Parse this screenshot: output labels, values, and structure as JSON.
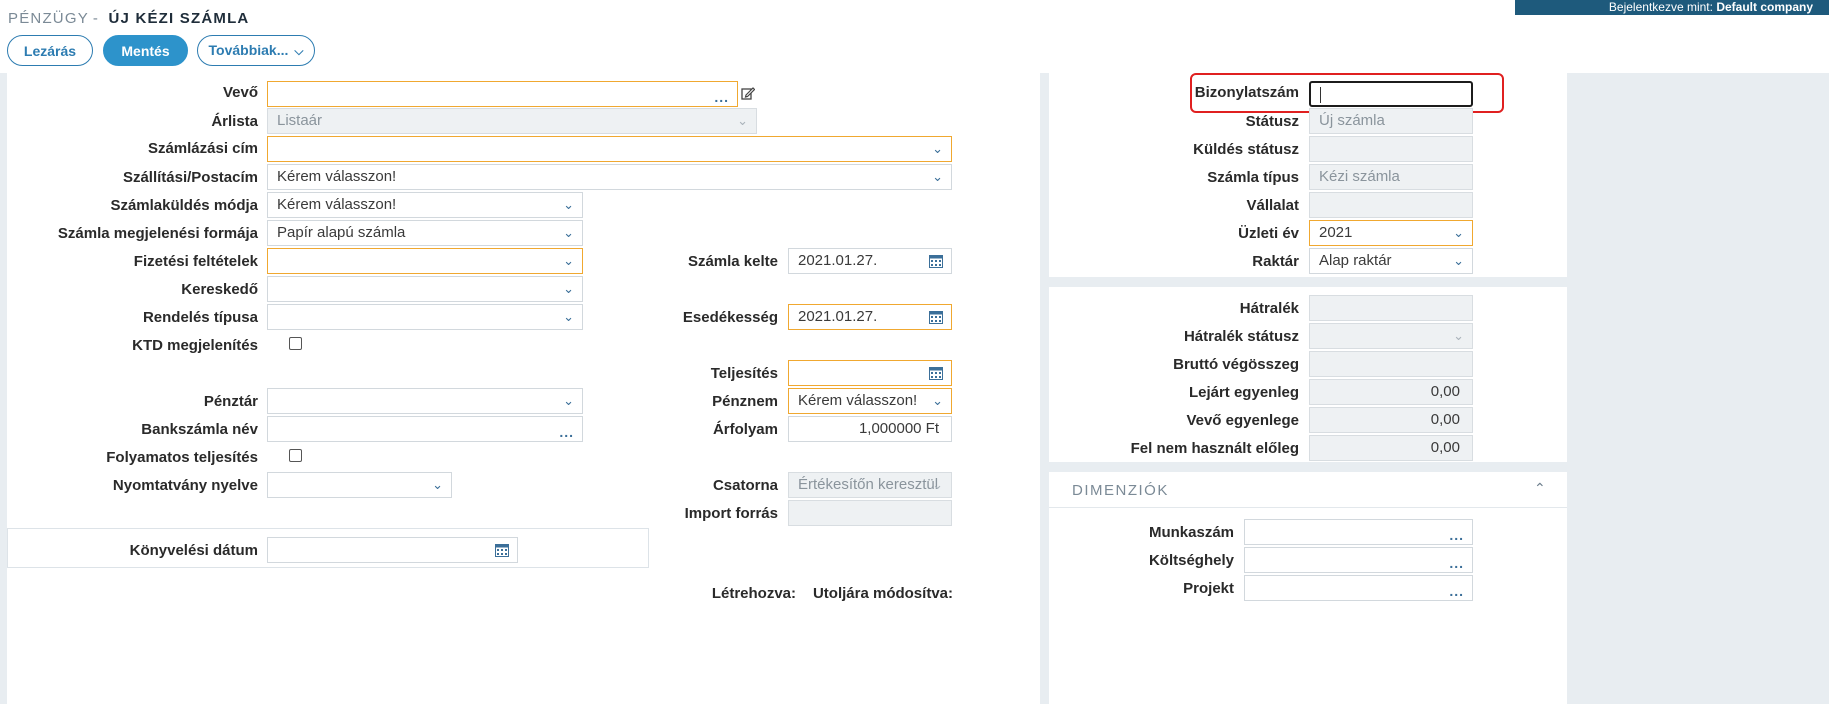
{
  "header": {
    "breadcrumb_section": "PÉNZÜGY",
    "breadcrumb_sep": "-",
    "page_title": "ÚJ KÉZI SZÁMLA",
    "login_prefix": "Bejelentkezve mint:",
    "login_company": "Default company"
  },
  "toolbar": {
    "close_label": "Lezárás",
    "save_label": "Mentés",
    "more_label": "Továbbiak..."
  },
  "form_left": {
    "vevo_label": "Vevő",
    "vevo_value": "",
    "arlista_label": "Árlista",
    "arlista_value": "Listaár",
    "szamlazasi_cim_label": "Számlázási cím",
    "szamlazasi_cim_value": "",
    "szallitasi_label": "Szállítási/Postacím",
    "szallitasi_value": "Kérem válasszon!",
    "kuldes_modja_label": "Számlaküldés módja",
    "kuldes_modja_value": "Kérem válasszon!",
    "megjelenesi_label": "Számla megjelenési formája",
    "megjelenesi_value": "Papír alapú számla",
    "fizetesi_label": "Fizetési feltételek",
    "fizetesi_value": "",
    "kereskedo_label": "Kereskedő",
    "kereskedo_value": "",
    "rendeles_label": "Rendelés típusa",
    "rendeles_value": "",
    "ktd_label": "KTD megjelenítés",
    "penztar_label": "Pénztár",
    "penztar_value": "",
    "bankszamla_label": "Bankszámla név",
    "bankszamla_value": "",
    "folyamatos_label": "Folyamatos teljesítés",
    "nyomtatvany_label": "Nyomtatvány nyelve",
    "nyomtatvany_value": "",
    "konyvelesi_label": "Könyvelési dátum",
    "konyvelesi_value": ""
  },
  "form_mid": {
    "kelte_label": "Számla kelte",
    "kelte_value": "2021.01.27.",
    "esedekesseg_label": "Esedékesség",
    "esedekesseg_value": "2021.01.27.",
    "teljesites_label": "Teljesítés",
    "teljesites_value": "",
    "penznem_label": "Pénznem",
    "penznem_value": "Kérem válasszon!",
    "arfolyam_label": "Árfolyam",
    "arfolyam_value": "1,000000 Ft",
    "csatorna_label": "Csatorna",
    "csatorna_value": "Értékesítőn keresztül",
    "import_label": "Import forrás",
    "import_value": "",
    "letrehozva_label": "Létrehozva:",
    "utoljara_label": "Utoljára módosítva:"
  },
  "form_right": {
    "bizonylatszam_label": "Bizonylatszám",
    "bizonylatszam_value": "",
    "statusz_label": "Státusz",
    "statusz_value": "Új számla",
    "kuldes_statusz_label": "Küldés státusz",
    "kuldes_statusz_value": "",
    "szamla_tipus_label": "Számla típus",
    "szamla_tipus_value": "Kézi számla",
    "vallalat_label": "Vállalat",
    "vallalat_value": "",
    "uzleti_ev_label": "Üzleti év",
    "uzleti_ev_value": "2021",
    "raktar_label": "Raktár",
    "raktar_value": "Alap raktár"
  },
  "form_balance": {
    "hatralek_label": "Hátralék",
    "hatralek_value": "",
    "hatralek_statusz_label": "Hátralék státusz",
    "hatralek_statusz_value": "",
    "brutto_label": "Bruttó végösszeg",
    "brutto_value": "",
    "lejart_label": "Lejárt egyenleg",
    "lejart_value": "0,00",
    "vevo_egyenlege_label": "Vevő egyenlege",
    "vevo_egyenlege_value": "0,00",
    "fel_nem_label": "Fel nem használt előleg",
    "fel_nem_value": "0,00"
  },
  "dimensions": {
    "title": "DIMENZIÓK",
    "munkaszam_label": "Munkaszám",
    "munkaszam_value": "",
    "koltseghely_label": "Költséghely",
    "koltseghely_value": "",
    "projekt_label": "Projekt",
    "projekt_value": ""
  },
  "icons": {
    "chevron": "chevron-down-icon",
    "dots": "ellipsis-icon",
    "calendar": "calendar-icon",
    "edit": "edit-icon",
    "collapse": "chevron-up-icon"
  },
  "colors": {
    "accent": "#2d93cb",
    "banner": "#1e5a7c",
    "required_border": "#f0a830",
    "highlight": "#e02020"
  }
}
